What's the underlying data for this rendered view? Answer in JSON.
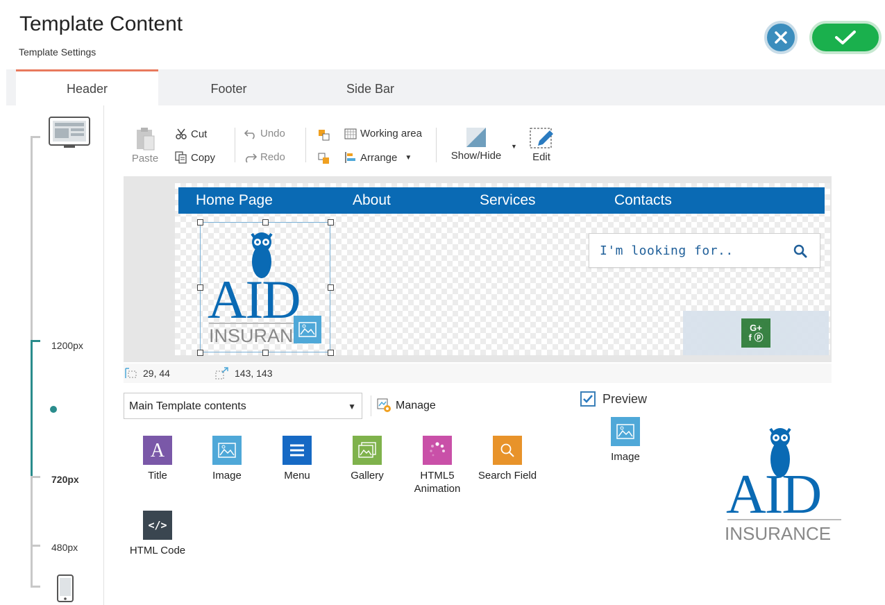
{
  "header": {
    "title": "Template Content",
    "subtitle": "Template Settings"
  },
  "tabs": [
    {
      "label": "Header",
      "active": true
    },
    {
      "label": "Footer",
      "active": false
    },
    {
      "label": "Side Bar",
      "active": false
    }
  ],
  "rail": {
    "labels": {
      "bp1200": "1200px",
      "bp720": "720px",
      "bp480": "480px"
    },
    "active": "720px"
  },
  "toolbar": {
    "paste": "Paste",
    "cut": "Cut",
    "copy": "Copy",
    "undo": "Undo",
    "redo": "Redo",
    "working_area": "Working area",
    "arrange": "Arrange",
    "show_hide": "Show/Hide",
    "edit": "Edit"
  },
  "canvas": {
    "nav": [
      "Home Page",
      "About",
      "Services",
      "Contacts"
    ],
    "logo_big": "AID",
    "logo_small": "INSURANCE",
    "search_placeholder": "I'm looking for..",
    "social_top": "G+",
    "social_bottom": "f ⓟ"
  },
  "coords": {
    "position": "29, 44",
    "size": "143, 143"
  },
  "panel": {
    "select_value": "Main Template contents",
    "manage": "Manage",
    "widgets": [
      {
        "label": "Title",
        "icon": "title-icon",
        "color": "#7a58a8"
      },
      {
        "label": "Image",
        "icon": "image-icon",
        "color": "#4fa8d8"
      },
      {
        "label": "Menu",
        "icon": "menu-icon",
        "color": "#1669c4"
      },
      {
        "label": "Gallery",
        "icon": "gallery-icon",
        "color": "#7fb24c"
      },
      {
        "label": "HTML5 Animation",
        "icon": "animation-icon",
        "color": "#c950a8"
      },
      {
        "label": "Search Field",
        "icon": "search-icon",
        "color": "#e8932a"
      },
      {
        "label": "HTML Code",
        "icon": "code-icon",
        "color": "#3a4650"
      }
    ],
    "preview_label": "Preview",
    "preview_checked": true,
    "preview_type": "Image",
    "preview_logo_big": "AID",
    "preview_logo_small": "INSURANCE"
  },
  "colors": {
    "brand_blue": "#0a6ab4",
    "accent_tab": "#e8795d",
    "ok_green": "#1ab04d",
    "rail_teal": "#2a8c8c"
  }
}
